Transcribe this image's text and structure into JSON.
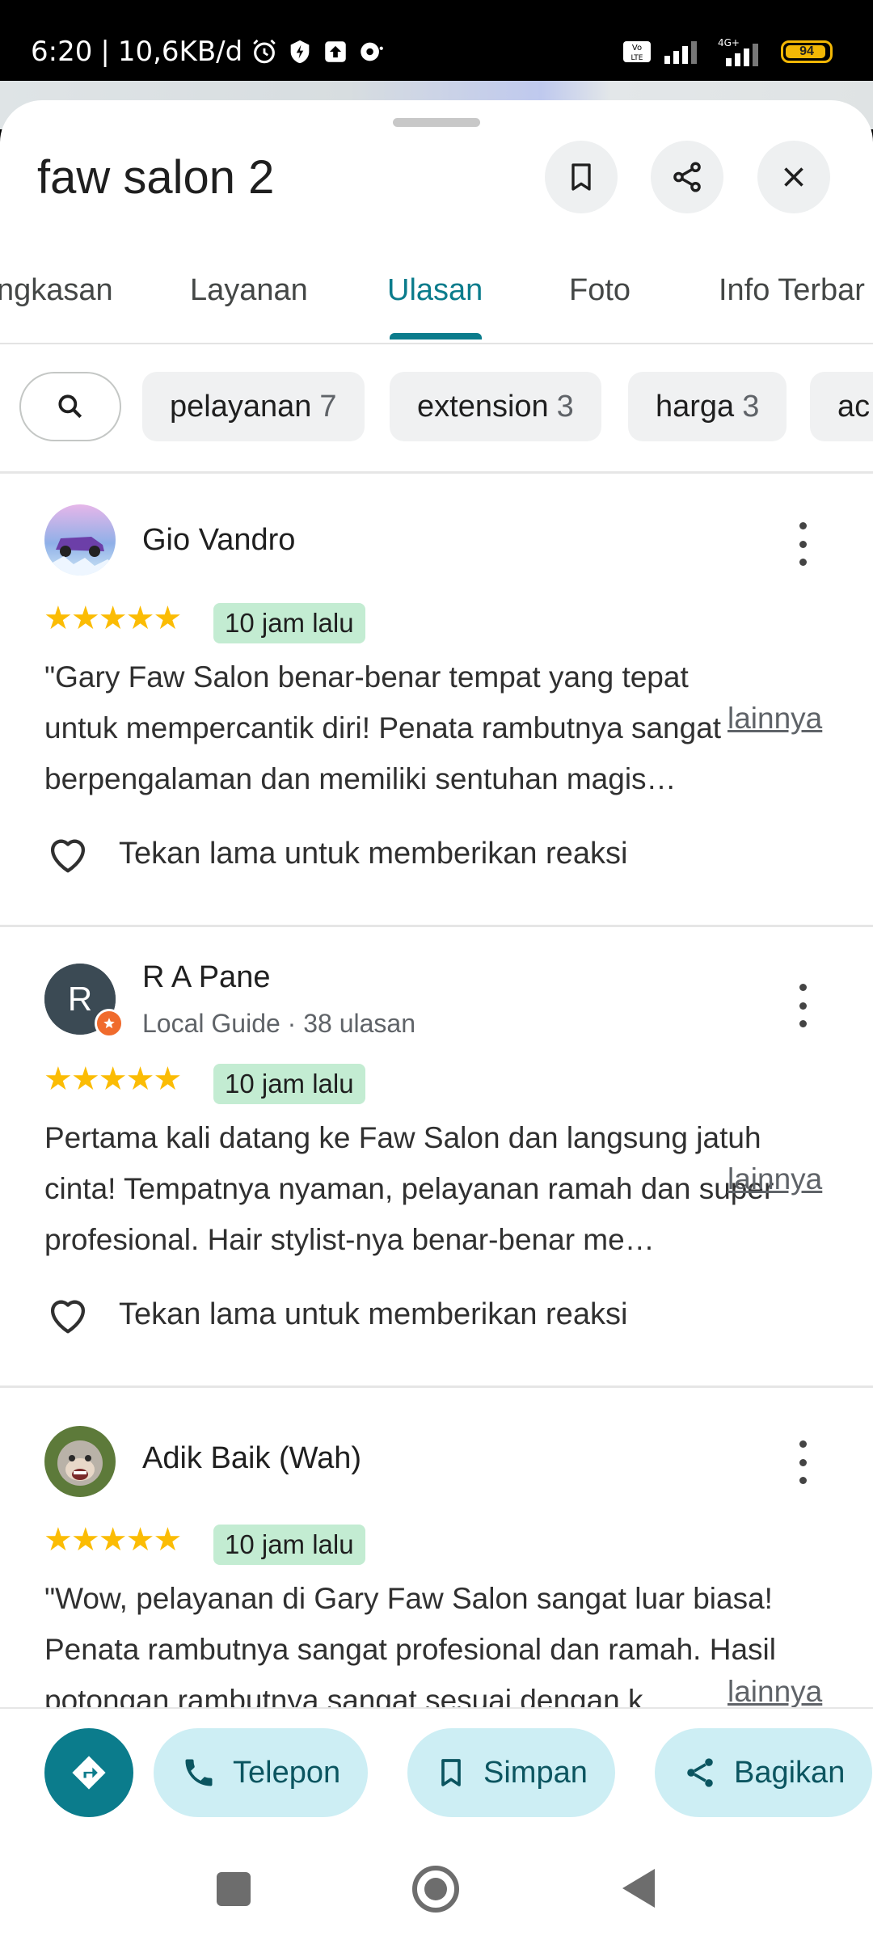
{
  "status_bar": {
    "time": "6:20",
    "net_speed": "10,6KB/d",
    "battery": "94",
    "battery_level": 0.94,
    "network": "4G+",
    "volte": "Vo LTE"
  },
  "place": {
    "title": "faw salon 2"
  },
  "tabs": [
    {
      "label": "ngkasan"
    },
    {
      "label": "Layanan"
    },
    {
      "label": "Ulasan",
      "active": true
    },
    {
      "label": "Foto"
    },
    {
      "label": "Info Terbar"
    }
  ],
  "chips": [
    {
      "label": "pelayanan",
      "count": "7"
    },
    {
      "label": "extension",
      "count": "3"
    },
    {
      "label": "harga",
      "count": "3"
    },
    {
      "label": "ac",
      "count": ""
    }
  ],
  "reviews": [
    {
      "name": "Gio Vandro",
      "subtitle": "",
      "rating": 5,
      "stars": "★★★★★",
      "time": "10 jam lalu",
      "lines": [
        "\"Gary Faw Salon benar-benar tempat yang tepat",
        "untuk mempercantik diri! Penata rambutnya sangat",
        "berpengalaman dan memiliki sentuhan magis…"
      ],
      "more": "lainnya",
      "reaction": "Tekan lama untuk memberikan reaksi"
    },
    {
      "name": "R A Pane",
      "avatar_letter": "R",
      "subtitle": "Local Guide · 38 ulasan",
      "rating": 5,
      "stars": "★★★★★",
      "time": "10 jam lalu",
      "lines": [
        "Pertama kali datang ke Faw Salon dan langsung jatuh",
        "cinta! Tempatnya nyaman, pelayanan ramah dan super",
        "profesional. Hair stylist-nya benar-benar me…"
      ],
      "more": "lainnya",
      "reaction": "Tekan lama untuk memberikan reaksi"
    },
    {
      "name": "Adik Baik (Wah)",
      "subtitle": "",
      "rating": 5,
      "stars": "★★★★★",
      "time": "10 jam lalu",
      "lines": [
        "\"Wow, pelayanan di Gary Faw Salon sangat luar biasa!",
        "Penata rambutnya sangat profesional dan ramah. Hasil",
        "potongan rambutnya sangat sesuai dengan k…"
      ],
      "more": "lainnya",
      "reaction": ""
    }
  ],
  "actions": {
    "call": "Telepon",
    "save": "Simpan",
    "share": "Bagikan"
  },
  "colors": {
    "accent": "#0b7c8c",
    "star": "#fbbc04",
    "time_badge": "#c3ecd2",
    "action_pill": "#cdeef4"
  }
}
